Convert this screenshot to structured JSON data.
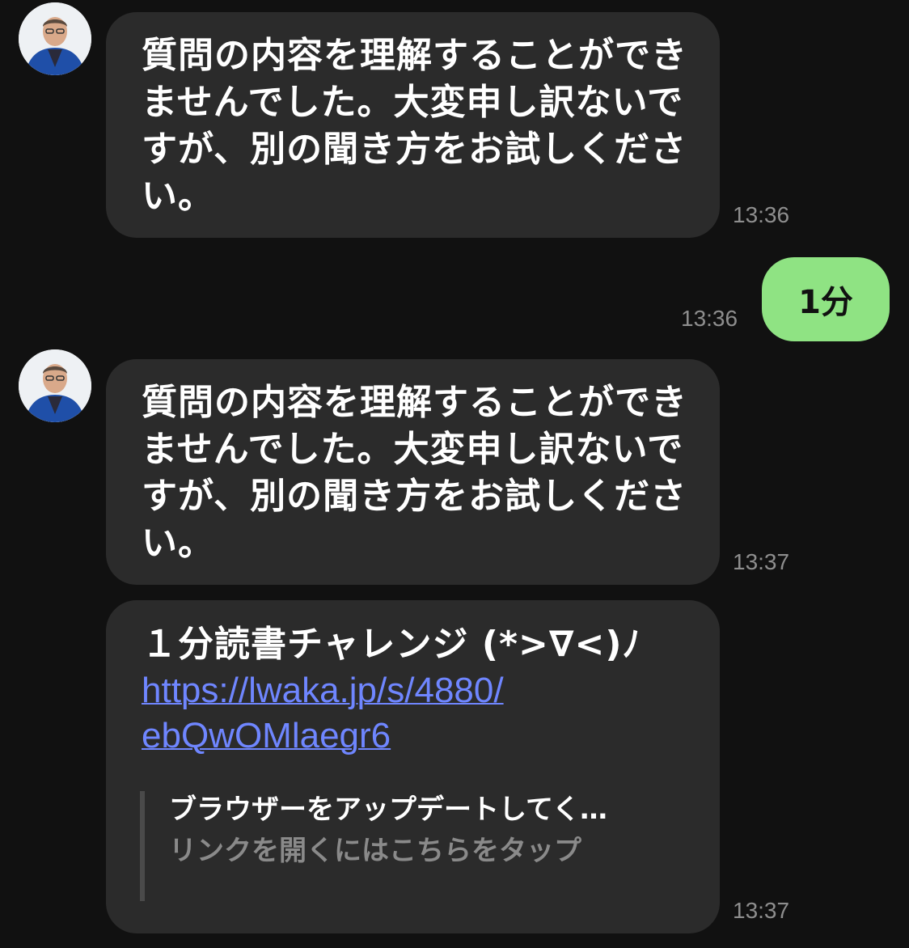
{
  "messages": [
    {
      "direction": "incoming",
      "text": "質問の内容を理解することができませんでした。大変申し訳ないですが、別の聞き方をお試しください。",
      "time": "13:36"
    },
    {
      "direction": "outgoing",
      "text": "1分",
      "time": "13:36"
    },
    {
      "direction": "incoming",
      "text": "質問の内容を理解することができませんでした。大変申し訳ないですが、別の聞き方をお試しください。",
      "time": "13:37"
    },
    {
      "direction": "incoming",
      "text": "１分読書チャレンジ (*>∇<)ﾉ",
      "link": "https://lwaka.jp/s/4880/ebQwOMlaegr6",
      "link_line1": "https://lwaka.jp/s/4880/",
      "link_line2": "ebQwOMlaegr6",
      "preview": {
        "title": "ブラウザーをアップデートしてく…",
        "subtitle": "リンクを開くにはこちらをタップ"
      },
      "time": "13:37"
    }
  ],
  "colors": {
    "background": "#111111",
    "incoming_bubble": "#2b2b2b",
    "outgoing_bubble": "#8fe383",
    "link": "#6f86ff",
    "timestamp": "#8e8e8e"
  },
  "icons": {
    "avatar": "user-avatar-photo"
  }
}
